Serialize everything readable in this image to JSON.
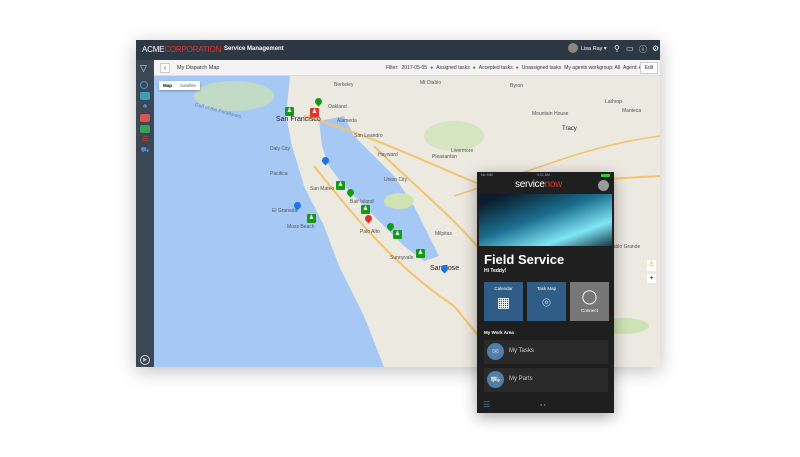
{
  "header": {
    "brand_part1": "ACME",
    "brand_part2": "CORPORATION",
    "app_name": "Service Management",
    "user_name": "Lisa Ray"
  },
  "subbar": {
    "title": "My Dispatch Map",
    "filter_label": "Filter:",
    "filter_date": "2017-05-05",
    "legend": [
      "Assigned tasks",
      "Accepted tasks",
      "Unassigned tasks"
    ],
    "workgroup": "My agents workgroup: All",
    "agent": "Agent: All",
    "edit_label": "Edit"
  },
  "map": {
    "type_buttons": [
      "Map",
      "Satellite"
    ],
    "ocean_label": "Gulf of the Farallones",
    "places": [
      "San Francisco",
      "Oakland",
      "Alameda",
      "Berkeley",
      "San Leandro",
      "Hayward",
      "Pleasanton",
      "Livermore",
      "Union City",
      "Daly City",
      "Pacifica",
      "San Mateo",
      "Bair Island",
      "Moss Beach",
      "El Granada",
      "Palo Alto",
      "Sunnyvale",
      "Milpitas",
      "San Jose",
      "Mt Diablo",
      "Byron",
      "Mountain House",
      "Tracy",
      "Lathrop",
      "Manteca",
      "Diablo Grande"
    ],
    "zoom_in": "+"
  },
  "colors": {
    "assigned": "#1a73e8",
    "accepted": "#159a15",
    "unassigned": "#e2332b"
  },
  "phone": {
    "status_carrier": "No SIM",
    "status_time": "9:31 AM",
    "brand_part1": "service",
    "brand_part2": "now",
    "title": "Field Service",
    "greeting": "Hi Teddy!",
    "tiles": [
      "Calendar",
      "Task Map",
      "Connect"
    ],
    "section": "My Work Area",
    "items": [
      "My Tasks",
      "My Parts"
    ]
  }
}
